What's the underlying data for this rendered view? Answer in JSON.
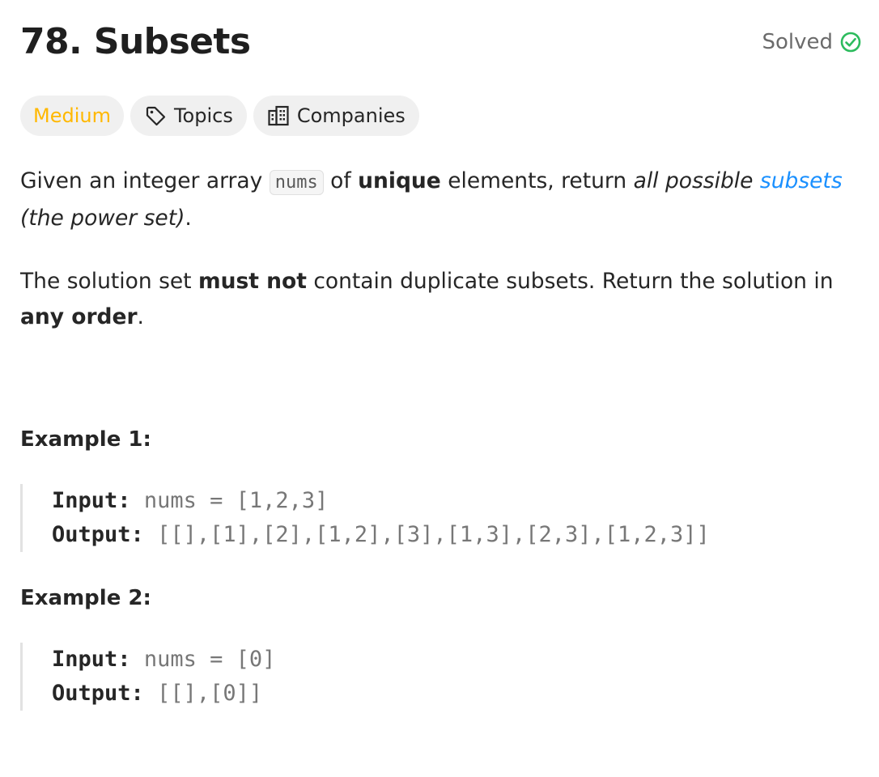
{
  "problem": {
    "title": "78. Subsets",
    "status": "Solved",
    "difficulty": "Medium",
    "topics_label": "Topics",
    "companies_label": "Companies"
  },
  "description": {
    "p1_part1": "Given an integer array ",
    "p1_code": "nums",
    "p1_part2": " of ",
    "p1_bold": "unique",
    "p1_part3": " elements, return ",
    "p1_italic1": "all possible ",
    "p1_link": "subsets",
    "p1_italic2": " (the power set)",
    "p1_end": ".",
    "p2_part1": "The solution set ",
    "p2_bold1": "must not",
    "p2_part2": " contain duplicate subsets. Return the solution in ",
    "p2_bold2": "any order",
    "p2_end": "."
  },
  "examples": [
    {
      "heading": "Example 1:",
      "input_label": "Input:",
      "input_value": "nums = [1,2,3]",
      "output_label": "Output:",
      "output_value": "[[],[1],[2],[1,2],[3],[1,3],[2,3],[1,2,3]]"
    },
    {
      "heading": "Example 2:",
      "input_label": "Input:",
      "input_value": "nums = [0]",
      "output_label": "Output:",
      "output_value": "[[],[0]]"
    }
  ],
  "colors": {
    "medium": "#ffb800",
    "solved_check": "#2cbb5d",
    "link": "#1a90ff"
  },
  "icons": {
    "solved": "check-circle-icon",
    "topics": "tag-icon",
    "companies": "building-icon"
  }
}
